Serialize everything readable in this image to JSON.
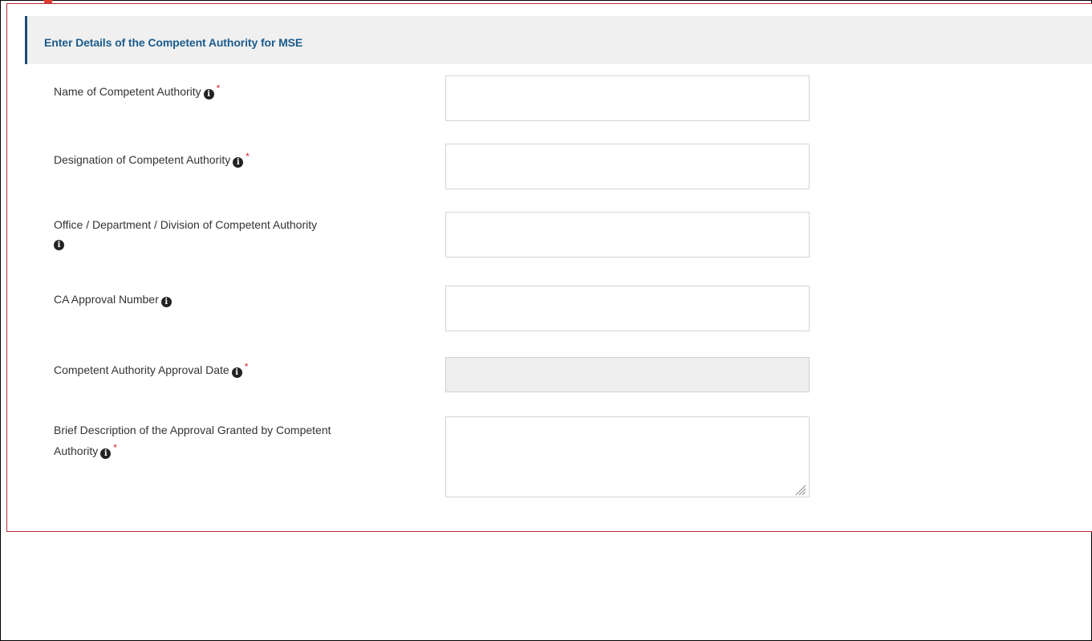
{
  "section": {
    "title": "Enter Details of the Competent Authority for MSE"
  },
  "fields": [
    {
      "label": "Name of Competent Authority",
      "required": true,
      "value": "",
      "type": "text"
    },
    {
      "label": "Designation of Competent Authority",
      "required": true,
      "value": "",
      "type": "text"
    },
    {
      "label": "Office / Department / Division of Competent Authority",
      "required": false,
      "value": "",
      "type": "text"
    },
    {
      "label": "CA Approval Number",
      "required": false,
      "value": "",
      "type": "text"
    },
    {
      "label": "Competent Authority Approval Date",
      "required": true,
      "value": "",
      "type": "date",
      "disabled": true
    },
    {
      "label": "Brief Description of the Approval Granted by Competent Authority",
      "required": true,
      "value": "",
      "type": "textarea"
    }
  ],
  "icons": {
    "info": "info-icon",
    "required_mark": "*"
  },
  "colors": {
    "title": "#1a5c8c",
    "header_accent": "#1a4e7a",
    "panel_border": "#b22a3a",
    "required": "#d9232d",
    "annotation_arrow": "#e03a2a"
  }
}
